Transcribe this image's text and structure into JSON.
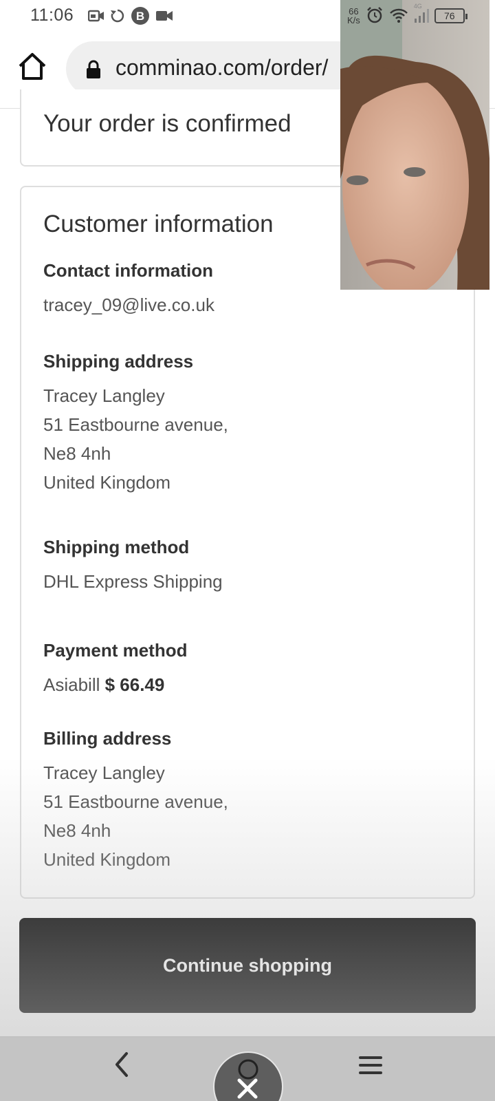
{
  "status_bar": {
    "time": "11:06",
    "net_speed_value": "66",
    "net_speed_unit": "K/s",
    "network_type": "4G",
    "battery": "76",
    "icons": [
      "video-camera-icon",
      "refresh-icon",
      "b-app-icon",
      "camcorder-icon",
      "alarm-icon",
      "wifi-icon",
      "signal-icon",
      "battery-icon"
    ]
  },
  "browser": {
    "url": "comminao.com/order/"
  },
  "order": {
    "confirmed_title": "Your order is confirmed"
  },
  "customer_info": {
    "title": "Customer information",
    "contact": {
      "heading": "Contact information",
      "email": "tracey_09@live.co.uk"
    },
    "shipping_address": {
      "heading": "Shipping address",
      "lines": [
        "Tracey Langley",
        "51 Eastbourne avenue,",
        "Ne8 4nh",
        "United Kingdom"
      ]
    },
    "shipping_method": {
      "heading": "Shipping method",
      "value": "DHL Express Shipping"
    },
    "payment_method": {
      "heading": "Payment method",
      "provider": "Asiabill",
      "amount": "$ 66.49"
    },
    "billing_address": {
      "heading": "Billing address",
      "lines": [
        "Tracey Langley",
        "51 Eastbourne avenue,",
        "Ne8 4nh",
        "United Kingdom"
      ]
    }
  },
  "actions": {
    "continue_label": "Continue shopping"
  },
  "colors": {
    "button_bg": "#000000",
    "button_text": "#ffffff",
    "border": "#dedede",
    "url_pill": "#efefef"
  }
}
